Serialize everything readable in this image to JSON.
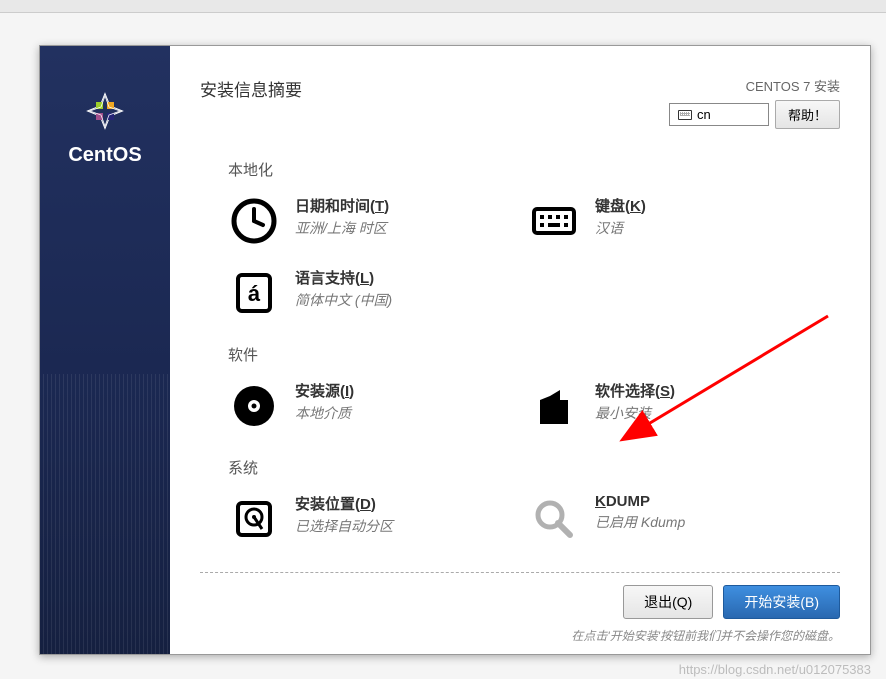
{
  "header": {
    "page_title": "安装信息摘要",
    "product_name": "CENTOS 7 安装",
    "lang_indicator": "cn",
    "help_button": "帮助！"
  },
  "brand": {
    "name": "CentOS"
  },
  "categories": [
    {
      "title": "本地化",
      "items": [
        {
          "icon": "clock",
          "title_pre": "日期和时间(",
          "title_ul": "T",
          "title_post": ")",
          "subtitle": "亚洲/上海 时区"
        },
        {
          "icon": "keyboard",
          "title_pre": "键盘(",
          "title_ul": "K",
          "title_post": ")",
          "subtitle": "汉语"
        },
        {
          "icon": "lang",
          "title_pre": "语言支持(",
          "title_ul": "L",
          "title_post": ")",
          "subtitle": "简体中文 (中国)"
        }
      ]
    },
    {
      "title": "软件",
      "items": [
        {
          "icon": "disc",
          "title_pre": "安装源(",
          "title_ul": "I",
          "title_post": ")",
          "subtitle": "本地介质"
        },
        {
          "icon": "package",
          "title_pre": "软件选择(",
          "title_ul": "S",
          "title_post": ")",
          "subtitle": "最小安装"
        }
      ]
    },
    {
      "title": "系统",
      "items": [
        {
          "icon": "hdd",
          "title_pre": "安装位置(",
          "title_ul": "D",
          "title_post": ")",
          "subtitle": "已选择自动分区"
        },
        {
          "icon": "search",
          "title_pre": "",
          "title_ul": "K",
          "title_post": "DUMP",
          "subtitle": "已启用 Kdump",
          "disabled": true
        }
      ]
    }
  ],
  "footer": {
    "quit_button": "退出(Q)",
    "begin_button": "开始安装(B)",
    "hint": "在点击'开始安装'按钮前我们并不会操作您的磁盘。"
  },
  "watermark": "https://blog.csdn.net/u012075383"
}
